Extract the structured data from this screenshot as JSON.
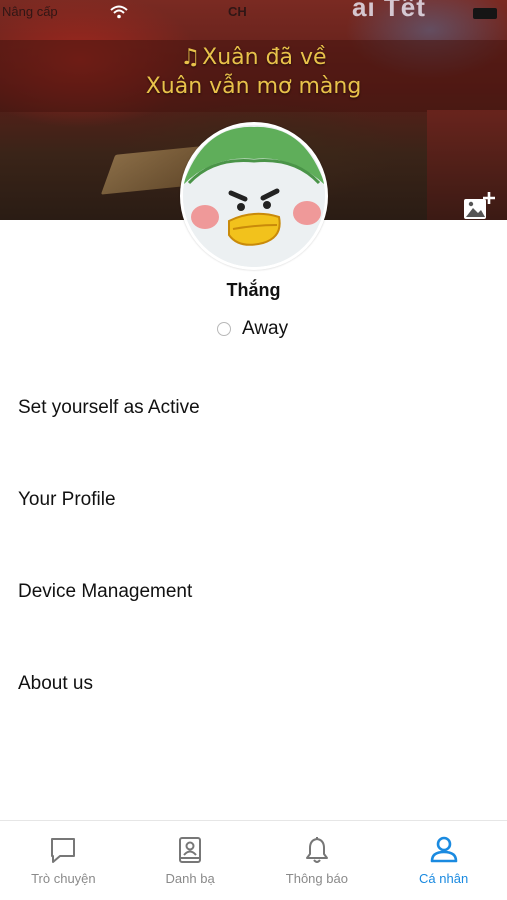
{
  "status_bar": {
    "carrier": "Nâng cấp",
    "time": "CH"
  },
  "cover": {
    "top_text": "ai Tết",
    "lyric_line1": "Xuân đã về",
    "lyric_line2": "Xuân vẫn mơ màng",
    "note_icon": "♫"
  },
  "profile": {
    "name": "Thắng",
    "status": "Away"
  },
  "menu": {
    "items": [
      {
        "label": "Set yourself as Active"
      },
      {
        "label": "Your Profile"
      },
      {
        "label": "Device Management"
      },
      {
        "label": "About us"
      }
    ]
  },
  "bottom_nav": {
    "items": [
      {
        "label": "Trò chuyện",
        "icon": "chat-bubble-icon"
      },
      {
        "label": "Danh bạ",
        "icon": "contact-book-icon"
      },
      {
        "label": "Thông báo",
        "icon": "bell-icon"
      },
      {
        "label": "Cá nhân",
        "icon": "person-icon"
      }
    ],
    "active_index": 3
  },
  "colors": {
    "accent": "#1a8ae0",
    "inactive": "#8a8a8a",
    "lyric": "#e8c24a"
  }
}
